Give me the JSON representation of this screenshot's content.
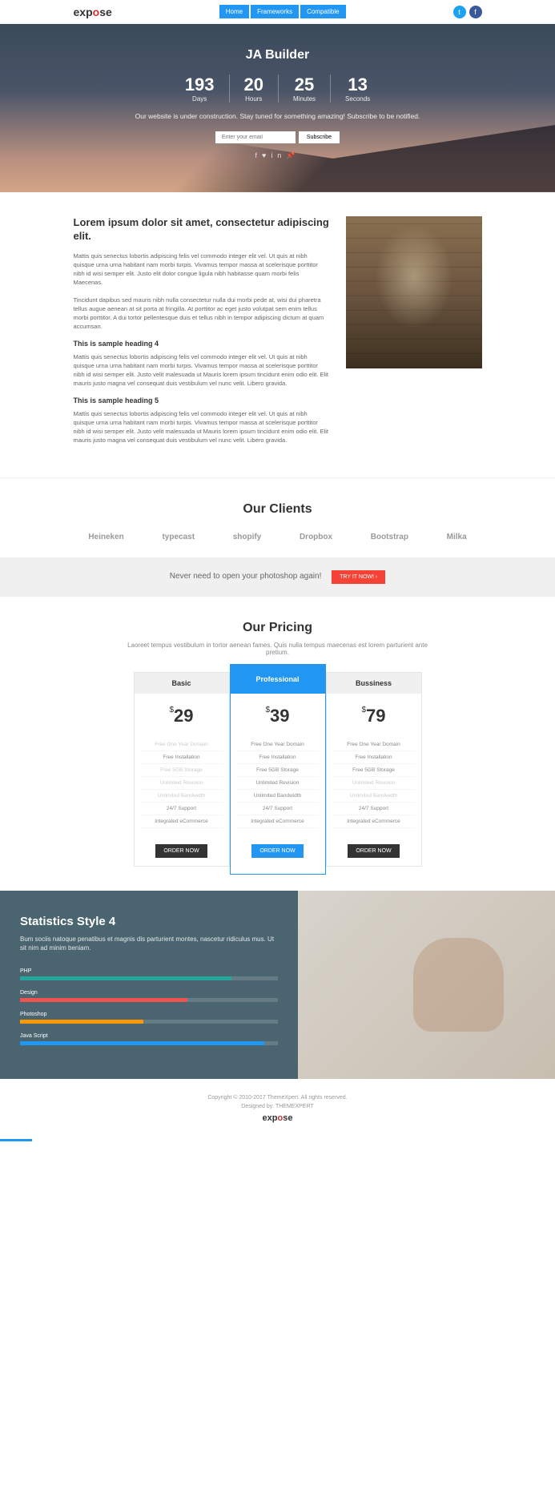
{
  "header": {
    "logo": "expose",
    "nav": [
      "Home",
      "Frameworks",
      "Compatible"
    ]
  },
  "hero": {
    "title": "JA Builder",
    "countdown": [
      {
        "num": "193",
        "label": "Days"
      },
      {
        "num": "20",
        "label": "Hours"
      },
      {
        "num": "25",
        "label": "Minutes"
      },
      {
        "num": "13",
        "label": "Seconds"
      }
    ],
    "text": "Our website is under construction. Stay tuned for something amazing!\nSubscribe to be notified.",
    "email_placeholder": "Enter your email",
    "subscribe_label": "Subscribe"
  },
  "content": {
    "heading": "Lorem ipsum dolor sit amet, consectetur adipiscing elit.",
    "para1": "Mattis quis senectus lobortis adipiscing felis vel commodo integer elit vel. Ut quis at nibh quisque urna urna habitant nam morbi turpis. Vivamus tempor massa at scelerisque porttitor nibh id wisi semper elit. Justo elit dolor congue ligula nibh habitasse quam morbi felis Maecenas.",
    "para2": "Tincidunt dapibus sed mauris nibh nulla consectetur nulla dui morbi pede at, wisi dui pharetra tellus augue aenean at sit porta at fringilla. At porttitor ac eget justo volutpat sem enim tellus morbi porttitor. A dui tortor pellentesque duis et tellus nibh in tempor adipiscing dictum at quam accumsan.",
    "heading4": "This is sample heading 4",
    "para3": "Mattis quis senectus lobortis adipiscing felis vel commodo integer elit vel. Ut quis at nibh quisque urna urna habitant nam morbi turpis. Vivamus tempor massa at scelerisque porttitor nibh id wisi semper elit. Justo velit malesuada ut Mauris lorem ipsum tincidunt enim odio elit. Elit mauris justo magna vel consequat duis vestibulum vel nunc velit. Libero gravida.",
    "heading5": "This is sample heading 5",
    "para4": "Mattis quis senectus lobortis adipiscing felis vel commodo integer elit vel. Ut quis at nibh quisque urna urna habitant nam morbi turpis. Vivamus tempor massa at scelerisque porttitor nibh id wisi semper elit. Justo velit malesuada ut Mauris lorem ipsum tincidunt enim odio elit. Elit mauris justo magna vel consequat duis vestibulum vel nunc velit. Libero gravida."
  },
  "clients": {
    "title": "Our Clients",
    "logos": [
      "Heineken",
      "typecast",
      "shopify",
      "Dropbox",
      "Bootstrap",
      "Milka"
    ]
  },
  "cta": {
    "text": "Never need to open your photoshop again!",
    "button": "TRY IT NOW! ›"
  },
  "pricing": {
    "title": "Our Pricing",
    "subtitle": "Laoreet tempus vestibulum in tortor aenean fames. Quis nulla tempus maecenas est lorem parturient ante pretium.",
    "plans": [
      {
        "name": "Basic",
        "price": "29",
        "features": [
          {
            "text": "Free One Year Domain",
            "muted": true
          },
          {
            "text": "Free Installation",
            "muted": false
          },
          {
            "text": "Free 5GB Storage",
            "muted": true
          },
          {
            "text": "Unlimited Revision",
            "muted": true
          },
          {
            "text": "Unlimited Bandwidth",
            "muted": true
          },
          {
            "text": "24/7 Support",
            "muted": false
          },
          {
            "text": "Integrated eCommerce",
            "muted": false
          }
        ],
        "button": "ORDER NOW",
        "featured": false
      },
      {
        "name": "Professional",
        "price": "39",
        "features": [
          {
            "text": "Free One Year Domain",
            "muted": false
          },
          {
            "text": "Free Installation",
            "muted": false
          },
          {
            "text": "Free 5GB Storage",
            "muted": false
          },
          {
            "text": "Unlimited Revision",
            "muted": false
          },
          {
            "text": "Unlimited Bandwidth",
            "muted": false
          },
          {
            "text": "24/7 Support",
            "muted": false
          },
          {
            "text": "Integrated eCommerce",
            "muted": false
          }
        ],
        "button": "ORDER NOW",
        "featured": true
      },
      {
        "name": "Bussiness",
        "price": "79",
        "features": [
          {
            "text": "Free One Year Domain",
            "muted": false
          },
          {
            "text": "Free Installation",
            "muted": false
          },
          {
            "text": "Free 5GB Storage",
            "muted": false
          },
          {
            "text": "Unlimited Revision",
            "muted": true
          },
          {
            "text": "Unlimited Bandwidth",
            "muted": true
          },
          {
            "text": "24/7 Support",
            "muted": false
          },
          {
            "text": "Integrated eCommerce",
            "muted": false
          }
        ],
        "button": "ORDER NOW",
        "featured": false
      }
    ]
  },
  "stats": {
    "title": "Statistics Style 4",
    "desc": "Bum sociis natoque penatibus et magnis dis parturient montes, nascetur ridiculus mus. Ut sit nim ad minim beniam.",
    "skills": [
      {
        "label": "PHP",
        "pct": 82,
        "color": "fill-teal"
      },
      {
        "label": "Design",
        "pct": 65,
        "color": "fill-red"
      },
      {
        "label": "Photoshop",
        "pct": 48,
        "color": "fill-orange"
      },
      {
        "label": "Java Script",
        "pct": 95,
        "color": "fill-blue"
      }
    ]
  },
  "footer": {
    "copyright": "Copyright © 2010-2017 ThemeXpert. All rights reserved.",
    "designed": "Designed by: THEMEXPERT",
    "logo": "expose"
  }
}
